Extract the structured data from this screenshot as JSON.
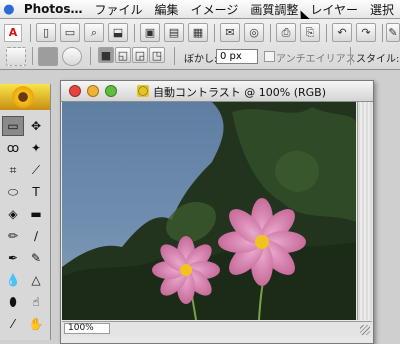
{
  "menubar": {
    "apple": "",
    "items": [
      "Photos…",
      "ファイル",
      "編集",
      "イメージ",
      "画質調整",
      "レイヤー",
      "選択"
    ]
  },
  "options": {
    "blur_label": "ぼかし:",
    "blur_value": "0 px",
    "antialias_label": "アンチエイリアス",
    "style_label": "スタイル:"
  },
  "document": {
    "title": "自動コントラスト @ 100% (RGB)",
    "zoom": "100%"
  },
  "colors": {
    "close": "#e6453e",
    "minimize": "#f2b233",
    "zoom": "#5fbf3c"
  }
}
